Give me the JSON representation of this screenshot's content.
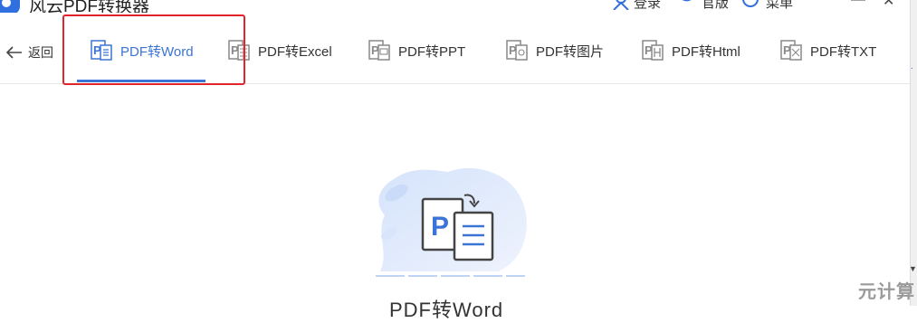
{
  "title_bar": {
    "app_title": "风云PDF转换器",
    "login_label": "登录",
    "version_label": "官版",
    "menu_label": "菜单"
  },
  "toolbar": {
    "back_label": "返回",
    "tabs": [
      {
        "label": "PDF转Word",
        "icon": "pdf-word-icon",
        "active": true
      },
      {
        "label": "PDF转Excel",
        "icon": "pdf-excel-icon",
        "active": false
      },
      {
        "label": "PDF转PPT",
        "icon": "pdf-ppt-icon",
        "active": false
      },
      {
        "label": "PDF转图片",
        "icon": "pdf-image-icon",
        "active": false
      },
      {
        "label": "PDF转Html",
        "icon": "pdf-html-icon",
        "active": false
      },
      {
        "label": "PDF转TXT",
        "icon": "pdf-txt-icon",
        "active": false
      }
    ]
  },
  "main": {
    "illustration_letter": "P",
    "caption": "PDF转Word"
  },
  "watermark": "元计算",
  "colors": {
    "accent": "#3b74d6",
    "highlight_box": "#e1252b",
    "illustration_bg": "#dde8fb"
  }
}
